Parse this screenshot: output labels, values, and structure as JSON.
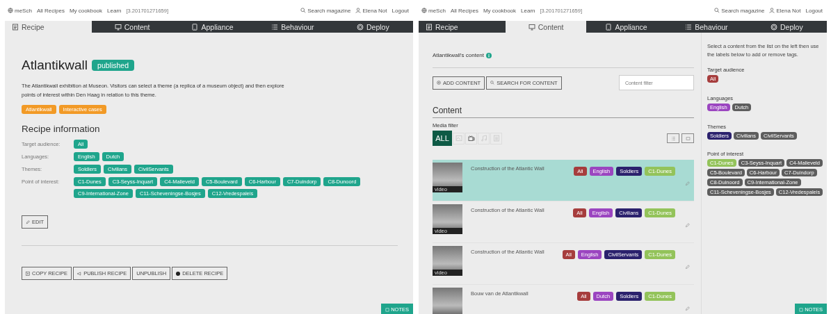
{
  "screens": [
    {
      "kind": "recipe",
      "nav": {
        "brand": "meSch",
        "links": [
          "All Recipes",
          "My cookbook",
          "Learn"
        ],
        "version": "[3.201701271659]",
        "search": "Search magazine",
        "user": "Elena Not",
        "logout": "Logout"
      },
      "tabs": [
        {
          "label": "Recipe",
          "selected": true
        },
        {
          "label": "Content",
          "selected": false
        },
        {
          "label": "Appliance",
          "selected": false
        },
        {
          "label": "Behaviour",
          "selected": false
        },
        {
          "label": "Deploy",
          "selected": false
        }
      ],
      "title": "Atlantikwall",
      "status": "published",
      "description": "The Atlantikwall exhibition at Museon. Visitors can select a theme (a replica of a museum object) and then explore points of interest within Den Haag in relation to this theme.",
      "tags": [
        "Atlantikwall",
        "Interactive cases"
      ],
      "info_heading": "Recipe information",
      "info": [
        {
          "label": "Target audience:",
          "values": [
            "All"
          ]
        },
        {
          "label": "Languages:",
          "values": [
            "English",
            "Dutch"
          ]
        },
        {
          "label": "Themes:",
          "values": [
            "Soldiers",
            "Civilians",
            "CivilServants"
          ]
        },
        {
          "label": "Point of interest:",
          "values": [
            "C1-Dunes",
            "C3-Seyss-Inquart",
            "C4-Malieveld",
            "C5-Boulevard",
            "C6-Harbour",
            "C7-Duindorp",
            "C8-Dunoord",
            "C9-International-Zone",
            "C11-Scheveningse-Bosjes",
            "C12-Vredespaleis"
          ]
        }
      ],
      "edit": "EDIT",
      "actions": [
        "COPY RECIPE",
        "PUBLISH RECIPE",
        "UNPUBLISH",
        "DELETE RECIPE"
      ],
      "notes": "NOTES"
    },
    {
      "kind": "content",
      "nav": {
        "brand": "meSch",
        "links": [
          "All Recipes",
          "My cookbook",
          "Learn"
        ],
        "version": "[3.201701271659]",
        "search": "Search magazine",
        "user": "Elena Not",
        "logout": "Logout"
      },
      "tabs": [
        {
          "label": "Recipe",
          "selected": false
        },
        {
          "label": "Content",
          "selected": true
        },
        {
          "label": "Appliance",
          "selected": false
        },
        {
          "label": "Behaviour",
          "selected": false
        },
        {
          "label": "Deploy",
          "selected": false
        }
      ],
      "content_title": "Atlantikwall's content",
      "buttons": [
        "ADD CONTENT",
        "SEARCH FOR CONTENT"
      ],
      "filter": {
        "placeholder": "Content filter"
      },
      "heading": "Content",
      "media_filter_label": "Media filter",
      "media_filter": [
        {
          "kind": "all",
          "label": "ALL",
          "selected": true,
          "disabled": false
        },
        {
          "kind": "image",
          "selected": false,
          "disabled": true
        },
        {
          "kind": "video",
          "selected": false,
          "disabled": false
        },
        {
          "kind": "audio",
          "selected": false,
          "disabled": true
        },
        {
          "kind": "text",
          "selected": false,
          "disabled": true
        }
      ],
      "rows": [
        {
          "title": "Construction of the Atlantic Wall",
          "media": "video",
          "selected": true,
          "tags": [
            {
              "label": "All",
              "color": "#a63d3d"
            },
            {
              "label": "English",
              "color": "#9b45c0"
            },
            {
              "label": "Soldiers",
              "color": "#2b216d"
            },
            {
              "label": "C1-Dunes",
              "color": "#93c35a"
            }
          ]
        },
        {
          "title": "Construction of the Atlantic Wall",
          "media": "video",
          "selected": false,
          "tags": [
            {
              "label": "All",
              "color": "#a63d3d"
            },
            {
              "label": "English",
              "color": "#9b45c0"
            },
            {
              "label": "Civilians",
              "color": "#2b216d"
            },
            {
              "label": "C1-Dunes",
              "color": "#93c35a"
            }
          ]
        },
        {
          "title": "Construction of the Atlantic Wall",
          "media": "video",
          "selected": false,
          "tags": [
            {
              "label": "All",
              "color": "#a63d3d"
            },
            {
              "label": "English",
              "color": "#9b45c0"
            },
            {
              "label": "CivilServants",
              "color": "#2b216d"
            },
            {
              "label": "C1-Dunes",
              "color": "#93c35a"
            }
          ]
        },
        {
          "title": "Bouw van de Atlantikwall",
          "selected": false,
          "tags": [
            {
              "label": "All",
              "color": "#a63d3d"
            },
            {
              "label": "Dutch",
              "color": "#9b45c0"
            },
            {
              "label": "Soldiers",
              "color": "#2b216d"
            },
            {
              "label": "C1-Dunes",
              "color": "#93c35a"
            }
          ]
        }
      ],
      "sidebar": {
        "instructions": "Select a content from the list on the left then use the labels below to add or remove tags.",
        "groups": [
          {
            "title": "Target audience",
            "tags": [
              {
                "label": "All",
                "selected": true,
                "color": "#a63d3d"
              }
            ]
          },
          {
            "title": "Languages",
            "tags": [
              {
                "label": "English",
                "selected": true,
                "color": "#9b45c0"
              },
              {
                "label": "Dutch",
                "selected": false
              }
            ]
          },
          {
            "title": "Themes",
            "tags": [
              {
                "label": "Soldiers",
                "selected": true,
                "color": "#2b216d"
              },
              {
                "label": "Civilians",
                "selected": false
              },
              {
                "label": "CivilServants",
                "selected": false
              }
            ]
          },
          {
            "title": "Point of interest",
            "tags": [
              {
                "label": "C1-Dunes",
                "selected": true,
                "color": "#93c35a"
              },
              {
                "label": "C3-Seyss-Inquart",
                "selected": false
              },
              {
                "label": "C4-Malieveld",
                "selected": false
              },
              {
                "label": "C5-Boulevard",
                "selected": false
              },
              {
                "label": "C6-Harbour",
                "selected": false
              },
              {
                "label": "C7-Duindorp",
                "selected": false
              },
              {
                "label": "C8-Duinoord",
                "selected": false
              },
              {
                "label": "C9-International-Zone",
                "selected": false
              },
              {
                "label": "C11-Scheveningse-Bosjes",
                "selected": false
              },
              {
                "label": "C12-Vredespaleis",
                "selected": false
              }
            ]
          }
        ]
      },
      "notes": "NOTES"
    }
  ]
}
